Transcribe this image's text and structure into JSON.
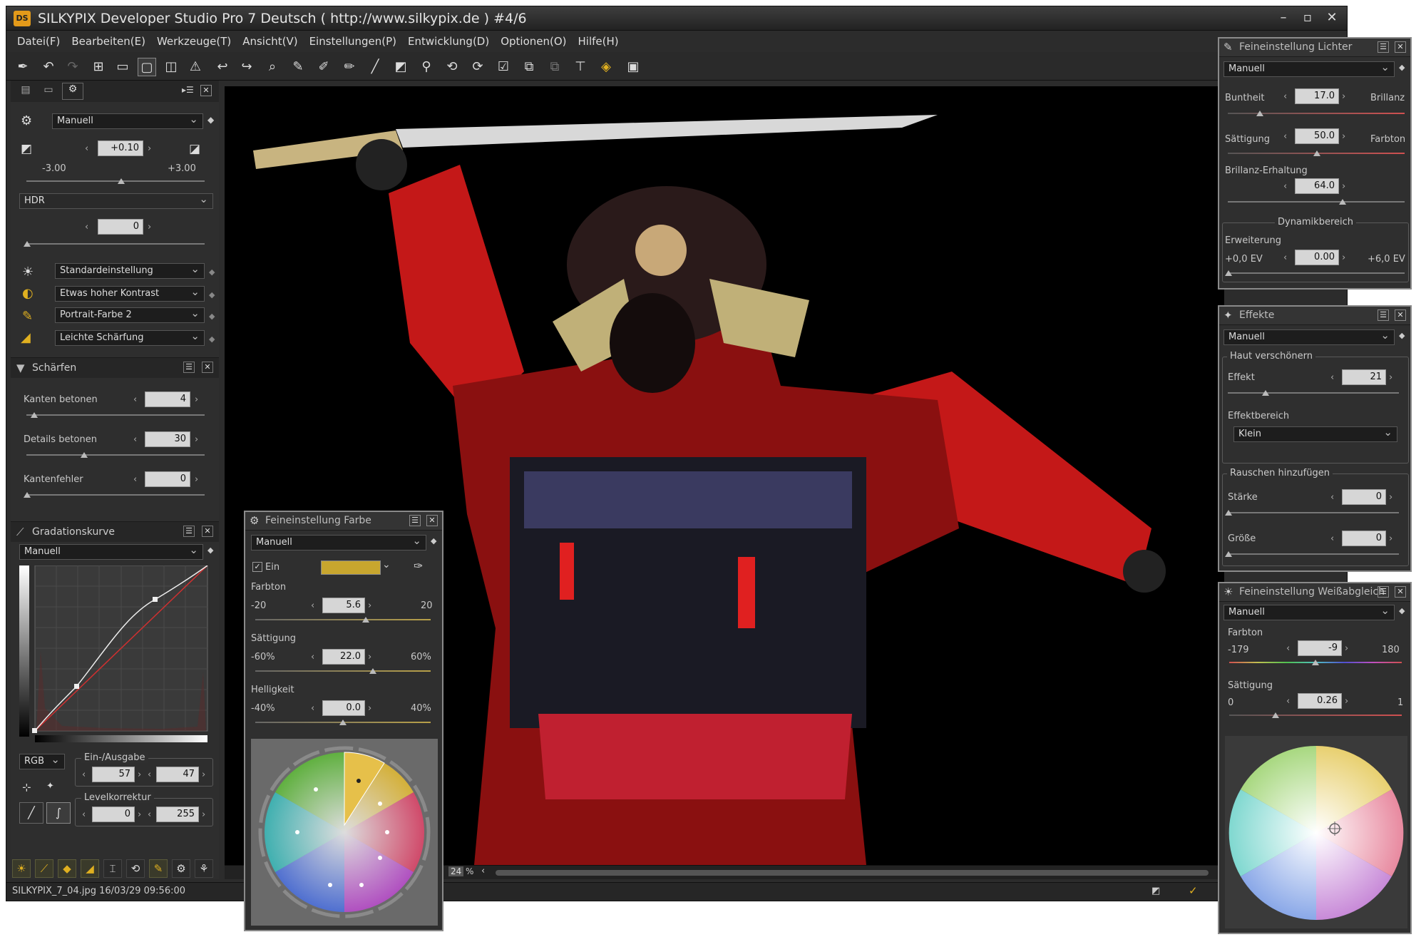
{
  "app": {
    "title": "SILKYPIX Developer Studio Pro 7 Deutsch ( http://www.silkypix.de )   #4/6",
    "logo": "DS",
    "window_controls": [
      "minimize-icon",
      "maximize-icon",
      "close-icon"
    ]
  },
  "menu": [
    "Datei(F)",
    "Bearbeiten(E)",
    "Werkzeuge(T)",
    "Ansicht(V)",
    "Einstellungen(P)",
    "Entwicklung(D)",
    "Optionen(O)",
    "Hilfe(H)"
  ],
  "toolbar_icons": [
    "develop-icon",
    "undo-icon",
    "redo-icon",
    "grid-view-icon",
    "filmstrip-view-icon",
    "single-view-icon",
    "compare-view-icon",
    "warning-icon",
    "prev-icon",
    "next-icon",
    "zoom-icon",
    "spot-icon",
    "brush-icon",
    "eraser-icon",
    "pen-icon",
    "fill-icon",
    "picker-icon",
    "rotate-left-icon",
    "rotate-right-icon",
    "check-icon",
    "copy-params-icon",
    "paste-params-icon",
    "crop-icon",
    "ds-icon",
    "screen-icon"
  ],
  "left": {
    "preset": "Manuell",
    "exposure": {
      "value": "+0.10",
      "min": "-3.00",
      "max": "+3.00"
    },
    "hdr": {
      "label": "HDR",
      "value": "0"
    },
    "styles": [
      "Standardeinstellung",
      "Etwas hoher Kontrast",
      "Portrait-Farbe 2",
      "Leichte Schärfung"
    ],
    "sharpen": {
      "title": "Schärfen",
      "rows": [
        {
          "label": "Kanten betonen",
          "value": "4"
        },
        {
          "label": "Details betonen",
          "value": "30"
        },
        {
          "label": "Kantenfehler",
          "value": "0"
        }
      ]
    },
    "curve": {
      "title": "Gradationskurve",
      "preset": "Manuell",
      "channel": "RGB",
      "io_title": "Ein-/Ausgabe",
      "io_in": "57",
      "io_out": "47",
      "level_title": "Levelkorrektur",
      "level_low": "0",
      "level_high": "255"
    }
  },
  "color_panel": {
    "title": "Feineinstellung Farbe",
    "preset": "Manuell",
    "on_label": "Ein",
    "swatch": "#c8a62e",
    "hue": {
      "label": "Farbton",
      "min": "-20",
      "value": "5.6",
      "max": "20"
    },
    "sat": {
      "label": "Sättigung",
      "min": "-60%",
      "value": "22.0",
      "max": "60%"
    },
    "light": {
      "label": "Helligkeit",
      "min": "-40%",
      "value": "0.0",
      "max": "40%"
    }
  },
  "highlights_panel": {
    "title": "Feineinstellung Lichter",
    "preset": "Manuell",
    "bunt_label": "Buntheit",
    "bunt_value": "17.0",
    "brillanz_label": "Brillanz",
    "sat_label": "Sättigung",
    "sat_value": "50.0",
    "farbton_label": "Farbton",
    "keep_label": "Brillanz-Erhaltung",
    "keep_value": "64.0",
    "dyn_title": "Dynamikbereich",
    "ext_label": "Erweiterung",
    "ext_min": "+0,0 EV",
    "ext_value": "0.00",
    "ext_max": "+6,0 EV"
  },
  "effects_panel": {
    "title": "Effekte",
    "preset": "Manuell",
    "skin_title": "Haut verschönern",
    "effect_label": "Effekt",
    "effect_value": "21",
    "area_label": "Effektbereich",
    "area_value": "Klein",
    "noise_title": "Rauschen hinzufügen",
    "strength_label": "Stärke",
    "strength_value": "0",
    "size_label": "Größe",
    "size_value": "0"
  },
  "wb_panel": {
    "title": "Feineinstellung Weißabgleich",
    "preset": "Manuell",
    "hue_label": "Farbton",
    "hue_min": "-179",
    "hue_value": "-9",
    "hue_max": "180",
    "sat_label": "Sättigung",
    "sat_min": "0",
    "sat_value": "0.26",
    "sat_max": "1"
  },
  "status": {
    "file": "SILKYPIX_7_04.jpg 16/03/29 09:56:00",
    "zoom": "24",
    "zoom_unit": "%"
  },
  "colors": {
    "accent": "#e0b020",
    "panel": "#2e2e2e",
    "viewer_bg": "#000000"
  }
}
